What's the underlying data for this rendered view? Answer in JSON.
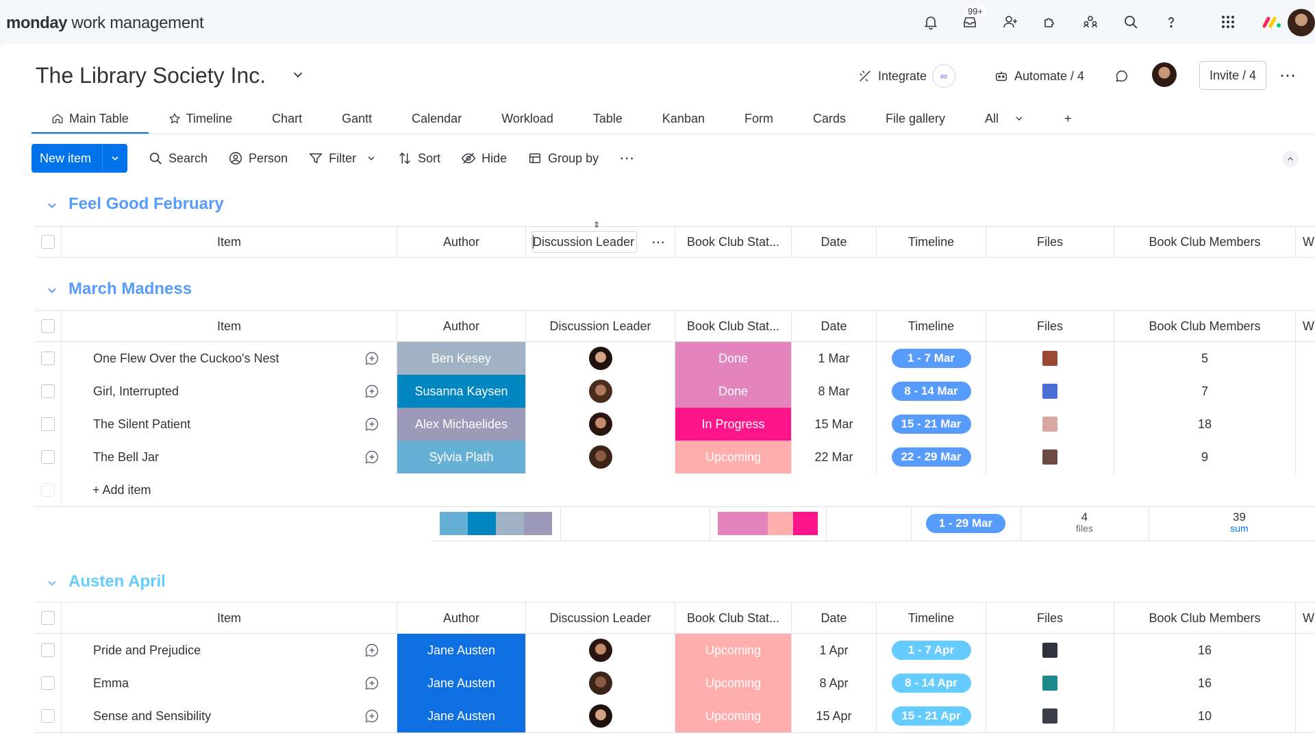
{
  "app": {
    "brand_bold": "monday",
    "brand_rest": " work management",
    "notif_badge": "99+"
  },
  "board": {
    "title": "The Library Society Inc.",
    "integrate": "Integrate",
    "automate": "Automate / 4",
    "invite": "Invite / 4"
  },
  "tabs": [
    {
      "label": "Main Table",
      "icon": "home-icon"
    },
    {
      "label": "Timeline",
      "icon": "star-icon"
    },
    {
      "label": "Chart"
    },
    {
      "label": "Gantt"
    },
    {
      "label": "Calendar"
    },
    {
      "label": "Workload"
    },
    {
      "label": "Table"
    },
    {
      "label": "Kanban"
    },
    {
      "label": "Form"
    },
    {
      "label": "Cards"
    },
    {
      "label": "File gallery"
    },
    {
      "label": "All"
    },
    {
      "label": "+"
    }
  ],
  "toolbar": {
    "new_item": "New item",
    "search": "Search",
    "person": "Person",
    "filter": "Filter",
    "sort": "Sort",
    "hide": "Hide",
    "group_by": "Group by"
  },
  "columns": {
    "item": "Item",
    "author": "Author",
    "discussion_leader": "Discussion Leader",
    "status": "Book Club Stat...",
    "date": "Date",
    "timeline": "Timeline",
    "files": "Files",
    "members": "Book Club Members",
    "more": "W"
  },
  "groups": [
    {
      "title": "Feel Good February",
      "color": "#579bfc"
    },
    {
      "title": "March Madness",
      "color": "#579bfc",
      "rows": [
        {
          "item": "One Flew Over the Cuckoo's Nest",
          "author": "Ben Kesey",
          "author_color": "#a1b2c4",
          "status": "Done",
          "status_color": "#e484bd",
          "date": "1 Mar",
          "timeline": "1 - 7 Mar",
          "timeline_color": "#579bfc",
          "members": "5",
          "thumb_color": "#9a4a32"
        },
        {
          "item": "Girl, Interrupted",
          "author": "Susanna Kaysen",
          "author_color": "#0086c0",
          "status": "Done",
          "status_color": "#e484bd",
          "date": "8 Mar",
          "timeline": "8 - 14 Mar",
          "timeline_color": "#579bfc",
          "members": "7",
          "thumb_color": "#4a6fd4"
        },
        {
          "item": "The Silent Patient",
          "author": "Alex Michaelides",
          "author_color": "#9d99b9",
          "status": "In Progress",
          "status_color": "#ff158a",
          "date": "15 Mar",
          "timeline": "15 - 21 Mar",
          "timeline_color": "#579bfc",
          "members": "18",
          "thumb_color": "#d7a7a0"
        },
        {
          "item": "The Bell Jar",
          "author": "Sylvia Plath",
          "author_color": "#66b0d6",
          "status": "Upcoming",
          "status_color": "#ffadad",
          "date": "22 Mar",
          "timeline": "22 - 29 Mar",
          "timeline_color": "#579bfc",
          "members": "9",
          "thumb_color": "#6b4a40"
        }
      ],
      "add_item": "+ Add item",
      "summary": {
        "timeline": "1 - 29 Mar",
        "files_count": "4",
        "files_label": "files",
        "members_sum": "39",
        "members_label": "sum"
      }
    },
    {
      "title": "Austen April",
      "color": "#66ccff",
      "rows": [
        {
          "item": "Pride and Prejudice",
          "author": "Jane Austen",
          "author_color": "#0f6fe0",
          "status": "Upcoming",
          "status_color": "#ffadad",
          "date": "1 Apr",
          "timeline": "1 - 7 Apr",
          "timeline_color": "#66ccff",
          "members": "16",
          "thumb_color": "#2e3340"
        },
        {
          "item": "Emma",
          "author": "Jane Austen",
          "author_color": "#0f6fe0",
          "status": "Upcoming",
          "status_color": "#ffadad",
          "date": "8 Apr",
          "timeline": "8 - 14 Apr",
          "timeline_color": "#66ccff",
          "members": "16",
          "thumb_color": "#1f8a8a"
        },
        {
          "item": "Sense and Sensibility",
          "author": "Jane Austen",
          "author_color": "#0f6fe0",
          "status": "Upcoming",
          "status_color": "#ffadad",
          "date": "15 Apr",
          "timeline": "15 - 21 Apr",
          "timeline_color": "#66ccff",
          "members": "10",
          "thumb_color": "#3a3f4a"
        }
      ]
    }
  ],
  "summary_author_colors": [
    "#66b0d6",
    "#0086c0",
    "#a1b2c4",
    "#9d99b9"
  ],
  "summary_status_colors": [
    "#e484bd",
    "#ffadad",
    "#ff158a"
  ]
}
